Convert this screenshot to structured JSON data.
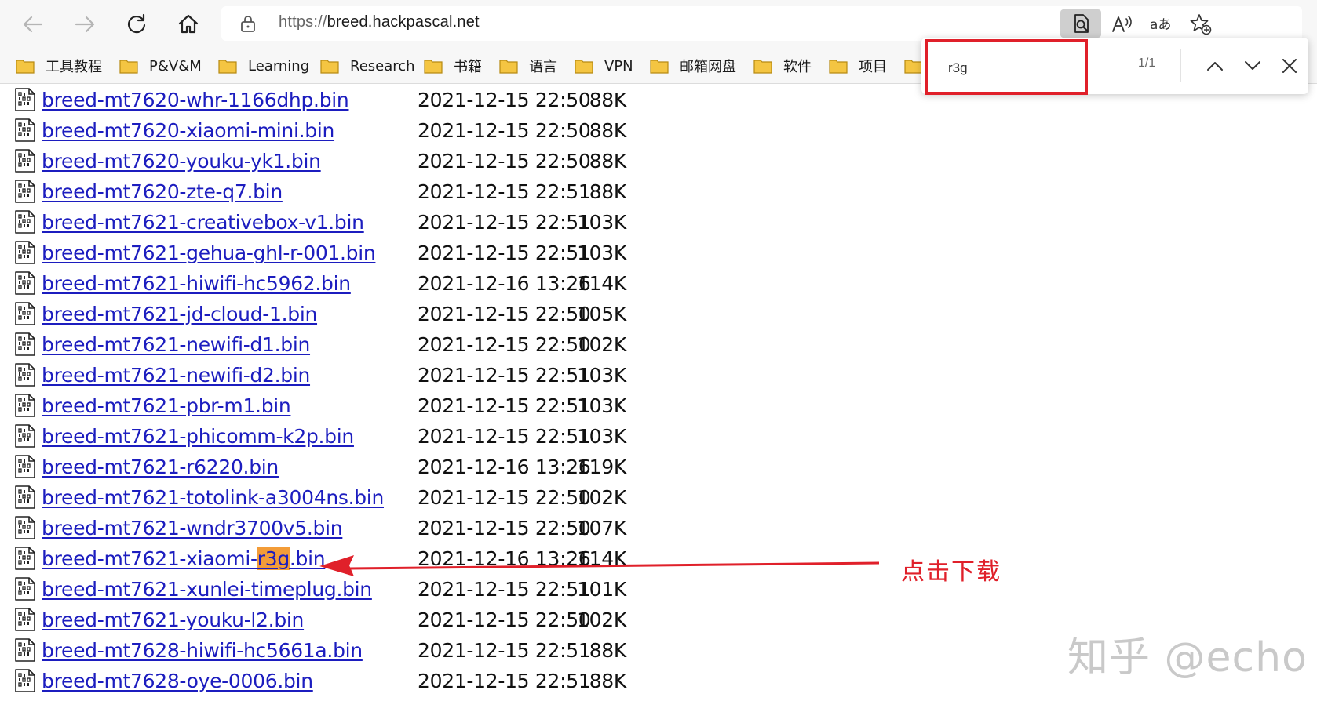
{
  "browser": {
    "url_scheme": "https://",
    "url_host": "breed.hackpascal.net",
    "icons": [
      "back-arrow-icon",
      "forward-arrow-icon",
      "refresh-icon",
      "home-icon",
      "lock-icon",
      "find-in-page-icon",
      "read-aloud-icon",
      "translate-icon",
      "favorites-add-icon"
    ]
  },
  "bookmarks": [
    {
      "label": "工具教程"
    },
    {
      "label": "P&V&M"
    },
    {
      "label": "Learning"
    },
    {
      "label": "Research"
    },
    {
      "label": "书籍"
    },
    {
      "label": "语言"
    },
    {
      "label": "VPN"
    },
    {
      "label": "邮箱网盘"
    },
    {
      "label": "软件"
    },
    {
      "label": "项目"
    },
    {
      "label": ""
    }
  ],
  "find": {
    "query": "r3g",
    "count": "1/1"
  },
  "files": [
    {
      "name": "breed-mt7620-whr-1166dhp.bin",
      "date": "2021-12-15 22:50",
      "size": "88K"
    },
    {
      "name": "breed-mt7620-xiaomi-mini.bin",
      "date": "2021-12-15 22:50",
      "size": "88K"
    },
    {
      "name": "breed-mt7620-youku-yk1.bin",
      "date": "2021-12-15 22:50",
      "size": "88K"
    },
    {
      "name": "breed-mt7620-zte-q7.bin",
      "date": "2021-12-15 22:51",
      "size": "88K"
    },
    {
      "name": "breed-mt7621-creativebox-v1.bin",
      "date": "2021-12-15 22:51",
      "size": "103K"
    },
    {
      "name": "breed-mt7621-gehua-ghl-r-001.bin",
      "date": "2021-12-15 22:51",
      "size": "103K"
    },
    {
      "name": "breed-mt7621-hiwifi-hc5962.bin",
      "date": "2021-12-16 13:26",
      "size": "114K"
    },
    {
      "name": "breed-mt7621-jd-cloud-1.bin",
      "date": "2021-12-15 22:50",
      "size": "105K"
    },
    {
      "name": "breed-mt7621-newifi-d1.bin",
      "date": "2021-12-15 22:50",
      "size": "102K"
    },
    {
      "name": "breed-mt7621-newifi-d2.bin",
      "date": "2021-12-15 22:51",
      "size": "103K"
    },
    {
      "name": "breed-mt7621-pbr-m1.bin",
      "date": "2021-12-15 22:51",
      "size": "103K"
    },
    {
      "name": "breed-mt7621-phicomm-k2p.bin",
      "date": "2021-12-15 22:51",
      "size": "103K"
    },
    {
      "name": "breed-mt7621-r6220.bin",
      "date": "2021-12-16 13:26",
      "size": "119K"
    },
    {
      "name": "breed-mt7621-totolink-a3004ns.bin",
      "date": "2021-12-15 22:50",
      "size": "102K"
    },
    {
      "name": "breed-mt7621-wndr3700v5.bin",
      "date": "2021-12-15 22:50",
      "size": "107K"
    },
    {
      "name": "breed-mt7621-xiaomi-r3g.bin",
      "name_pre": "breed-mt7621-xiaomi-",
      "name_hl": "r3g",
      "name_post": ".bin",
      "date": "2021-12-16 13:26",
      "size": "114K"
    },
    {
      "name": "breed-mt7621-xunlei-timeplug.bin",
      "date": "2021-12-15 22:51",
      "size": "101K"
    },
    {
      "name": "breed-mt7621-youku-l2.bin",
      "date": "2021-12-15 22:50",
      "size": "102K"
    },
    {
      "name": "breed-mt7628-hiwifi-hc5661a.bin",
      "date": "2021-12-15 22:51",
      "size": "88K"
    },
    {
      "name": "breed-mt7628-oye-0006.bin",
      "date": "2021-12-15 22:51",
      "size": "88K"
    }
  ],
  "annotation": {
    "label": "点击下载",
    "color": "#e0202a"
  },
  "watermark": "知乎 @echo"
}
